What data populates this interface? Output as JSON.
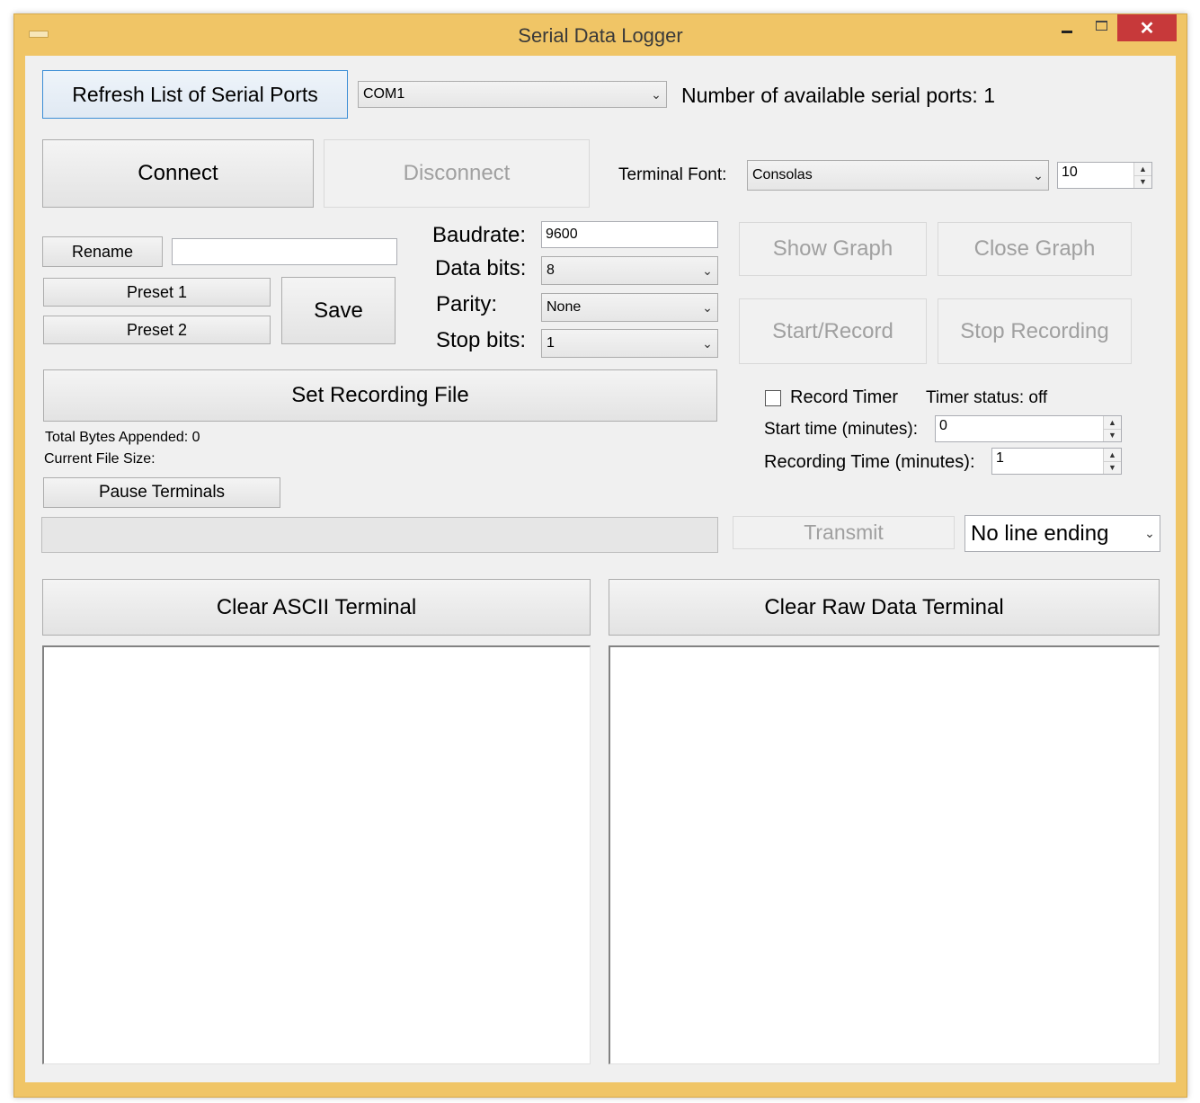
{
  "window": {
    "title": "Serial Data Logger",
    "close_glyph": "✕"
  },
  "ports": {
    "refresh_label": "Refresh List of Serial Ports",
    "selected_port": "COM1",
    "available_text": "Number of available serial ports: 1"
  },
  "connection": {
    "connect_label": "Connect",
    "disconnect_label": "Disconnect"
  },
  "terminal_font": {
    "label": "Terminal Font:",
    "font": "Consolas",
    "size": "10"
  },
  "presets": {
    "rename_label": "Rename",
    "rename_value": "",
    "preset1_label": "Preset 1",
    "preset2_label": "Preset 2",
    "save_label": "Save"
  },
  "serial_settings": {
    "baudrate_label": "Baudrate:",
    "baudrate_value": "9600",
    "databits_label": "Data bits:",
    "databits_value": "8",
    "parity_label": "Parity:",
    "parity_value": "None",
    "stopbits_label": "Stop bits:",
    "stopbits_value": "1"
  },
  "graph": {
    "show_label": "Show Graph",
    "close_label": "Close Graph"
  },
  "recording": {
    "start_label": "Start/Record",
    "stop_label": "Stop Recording",
    "set_file_label": "Set Recording File",
    "total_bytes_text": "Total Bytes Appended: 0",
    "file_size_text": "Current File Size:",
    "pause_label": "Pause Terminals"
  },
  "timer": {
    "record_timer_label": "Record Timer",
    "status_text": "Timer status: off",
    "start_time_label": "Start time (minutes):",
    "start_time_value": "0",
    "recording_time_label": "Recording Time (minutes):",
    "recording_time_value": "1"
  },
  "transmit": {
    "input_value": "",
    "transmit_label": "Transmit",
    "line_ending": "No line ending"
  },
  "terminals": {
    "clear_ascii_label": "Clear ASCII Terminal",
    "clear_raw_label": "Clear Raw Data Terminal"
  },
  "icons": {
    "dropdown": "chevron-down-icon",
    "spin_up": "▲",
    "spin_down": "▼"
  },
  "colors": {
    "title_bar": "#f0c566",
    "close_button": "#c7393a",
    "focus_border": "#3c8ed6"
  }
}
